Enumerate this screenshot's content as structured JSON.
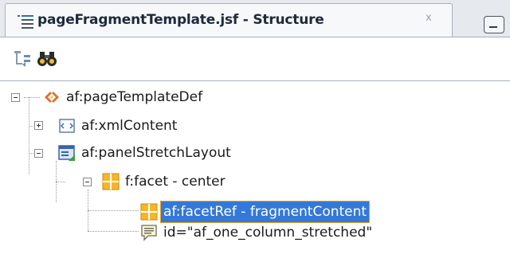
{
  "tab": {
    "title": "pageFragmentTemplate.jsf - Structure",
    "close_glyph": "x",
    "icon": "structure-icon"
  },
  "toolbar": {
    "buttons": [
      {
        "name": "synchronize-icon"
      },
      {
        "name": "find-binoculars-icon"
      }
    ]
  },
  "tree": {
    "nodes": [
      {
        "label": "af:pageTemplateDef",
        "icon": "page-template-icon",
        "expanded": true,
        "selected": false
      },
      {
        "label": "af:xmlContent",
        "icon": "xml-content-icon",
        "expanded": false,
        "selected": false
      },
      {
        "label": "af:panelStretchLayout",
        "icon": "panel-stretch-layout-icon",
        "expanded": true,
        "selected": false
      },
      {
        "label": "f:facet - center",
        "icon": "facet-icon",
        "expanded": true,
        "selected": false
      },
      {
        "label": "af:facetRef - fragmentContent",
        "icon": "facet-ref-icon",
        "selected": true
      },
      {
        "label": "id=\"af_one_column_stretched\"",
        "icon": "attribute-comment-icon",
        "selected": false
      }
    ]
  },
  "colors": {
    "selection": "#3478d8",
    "selection_border": "#e7a21a",
    "tab_background": "#e6e9ee"
  }
}
